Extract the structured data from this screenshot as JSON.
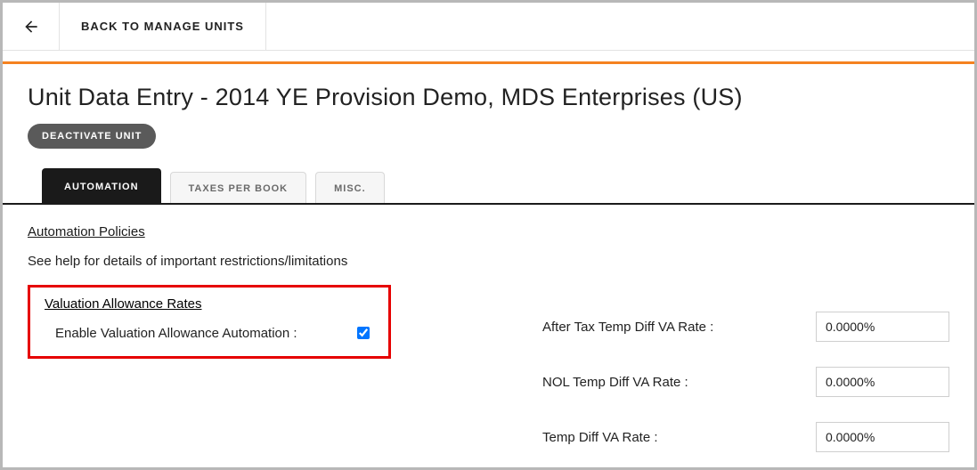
{
  "header": {
    "back_label": "BACK TO MANAGE UNITS"
  },
  "page_title": "Unit Data Entry - 2014 YE Provision Demo, MDS Enterprises (US)",
  "buttons": {
    "deactivate": "DEACTIVATE UNIT"
  },
  "tabs": [
    {
      "label": "AUTOMATION",
      "active": true
    },
    {
      "label": "TAXES PER BOOK",
      "active": false
    },
    {
      "label": "MISC.",
      "active": false
    }
  ],
  "section": {
    "policies_link": "Automation Policies",
    "help_text": "See help for details of important restrictions/limitations",
    "valuation": {
      "heading": "Valuation Allowance Rates",
      "enable_label": "Enable Valuation Allowance Automation :",
      "enable_checked": true
    },
    "rates": [
      {
        "label": "After Tax Temp Diff VA Rate :",
        "value": "0.0000%"
      },
      {
        "label": "NOL Temp Diff VA Rate :",
        "value": "0.0000%"
      },
      {
        "label": "Temp Diff VA Rate :",
        "value": "0.0000%"
      }
    ]
  }
}
